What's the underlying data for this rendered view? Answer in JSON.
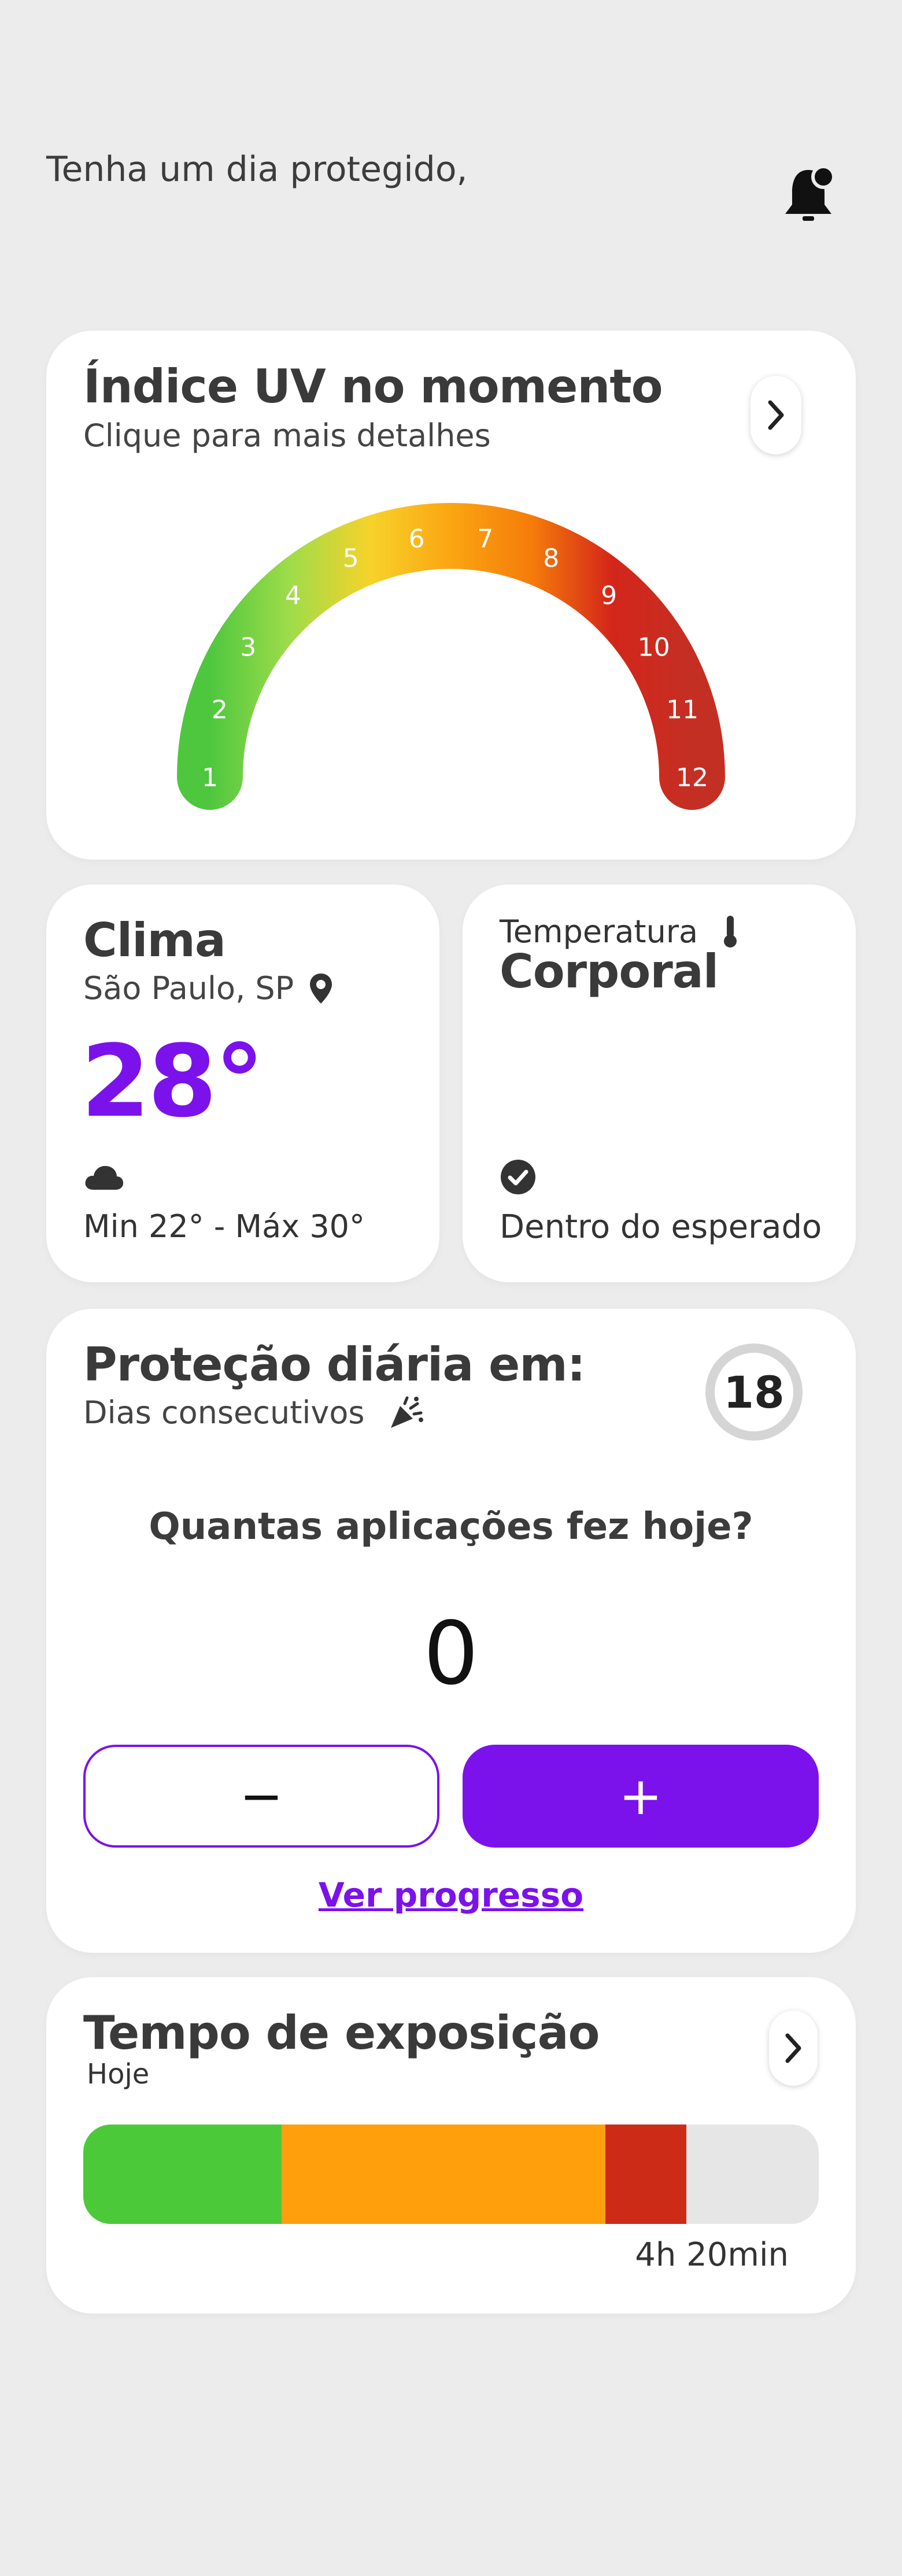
{
  "header": {
    "greeting": "Tenha  um dia protegido,",
    "bell_icon": "notification-bell-icon"
  },
  "uv_card": {
    "title": "Índice UV no momento",
    "subtitle": "Clique para mais detalhes",
    "scale_labels": [
      "1",
      "2",
      "3",
      "4",
      "5",
      "6",
      "7",
      "8",
      "9",
      "10",
      "11",
      "12"
    ],
    "gradient_colors": [
      "#4ec73f",
      "#9fdc4a",
      "#f7d22a",
      "#fba512",
      "#f57c0a",
      "#d4261a",
      "#c42f24"
    ]
  },
  "clima_card": {
    "title": "Clima",
    "location": "São Paulo, SP",
    "location_icon": "map-pin-icon",
    "temperature": "28°",
    "weather_icon": "cloud-icon",
    "minmax": "Min 22° - Máx 30°"
  },
  "temp_card": {
    "label": "Temperatura",
    "thermometer_icon": "thermometer-icon",
    "title": "Corporal",
    "status_icon": "check-circle-icon",
    "status": "Dentro do esperado"
  },
  "protection_card": {
    "title": "Proteção diária em:",
    "subtitle": "Dias consecutivos",
    "party_icon": "party-popper-icon",
    "streak": "18",
    "question": "Quantas aplicações fez hoje?",
    "count": "0",
    "minus_label": "−",
    "plus_label": "+",
    "progress_link": "Ver progresso"
  },
  "exposure_card": {
    "title": "Tempo de exposição",
    "subtitle": "Hoje",
    "time": "4h 20min",
    "segments": [
      {
        "color": "#4cc939",
        "fraction": 0.27
      },
      {
        "color": "#ff9f0c",
        "fraction": 0.44
      },
      {
        "color": "#cc2b18",
        "fraction": 0.11
      }
    ]
  },
  "colors": {
    "accent": "#7b12ec",
    "background": "#ececec"
  }
}
